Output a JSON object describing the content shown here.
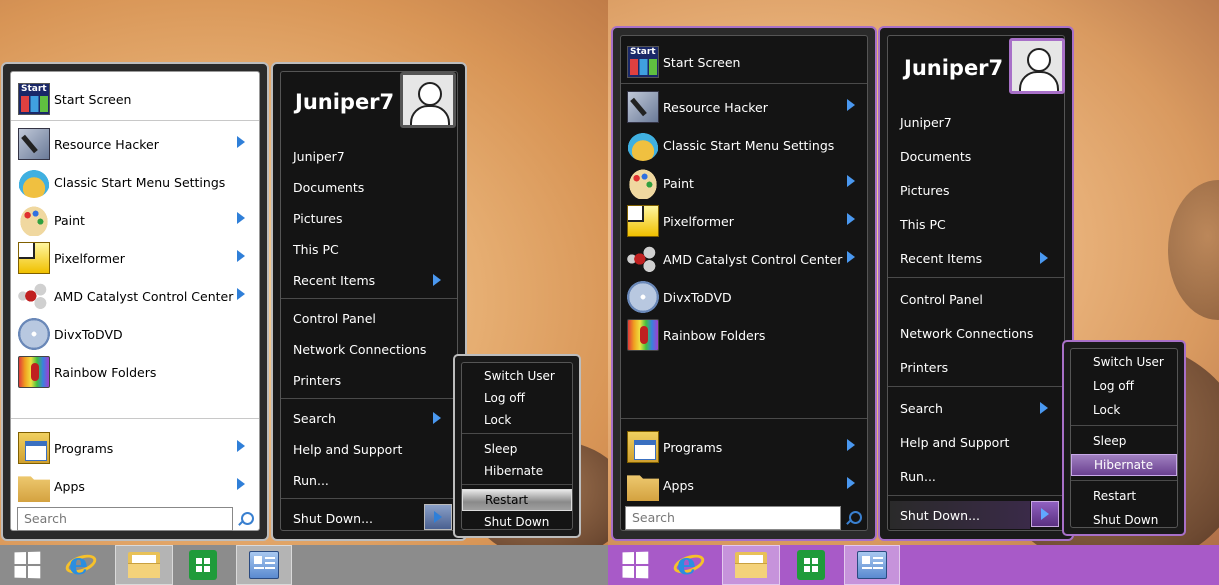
{
  "left": {
    "programs_list": [
      {
        "label": "Start Screen",
        "icon": "start-screen-icon",
        "submenu": false
      },
      {
        "label": "Resource Hacker",
        "icon": "resource-hacker-icon",
        "submenu": true
      },
      {
        "label": "Classic Start Menu Settings",
        "icon": "classic-shell-icon",
        "submenu": false
      },
      {
        "label": "Paint",
        "icon": "paint-icon",
        "submenu": true
      },
      {
        "label": "Pixelformer",
        "icon": "pixelformer-icon",
        "submenu": true
      },
      {
        "label": "AMD Catalyst Control Center",
        "icon": "amd-catalyst-icon",
        "submenu": true
      },
      {
        "label": "DivxToDVD",
        "icon": "divxtodvd-icon",
        "submenu": false
      },
      {
        "label": "Rainbow Folders",
        "icon": "rainbow-folders-icon",
        "submenu": false
      }
    ],
    "programs_label": "Programs",
    "apps_label": "Apps",
    "search_placeholder": "Search",
    "user_name": "Juniper7",
    "right_items": [
      {
        "label": "Juniper7",
        "submenu": false
      },
      {
        "label": "Documents",
        "submenu": false
      },
      {
        "label": "Pictures",
        "submenu": false
      },
      {
        "label": "This PC",
        "submenu": false
      },
      {
        "label": "Recent Items",
        "submenu": true
      },
      {
        "label": "Control Panel",
        "submenu": false
      },
      {
        "label": "Network Connections",
        "submenu": false
      },
      {
        "label": "Printers",
        "submenu": false
      },
      {
        "label": "Search",
        "submenu": true
      },
      {
        "label": "Help and Support",
        "submenu": false
      },
      {
        "label": "Run...",
        "submenu": false
      }
    ],
    "shutdown_label": "Shut Down...",
    "power_menu": [
      "Switch User",
      "Log off",
      "Lock",
      "Sleep",
      "Hibernate",
      "Restart",
      "Shut Down"
    ],
    "power_highlighted": "Restart"
  },
  "right": {
    "programs_list": [
      {
        "label": "Start Screen",
        "icon": "start-screen-icon",
        "submenu": false
      },
      {
        "label": "Resource Hacker",
        "icon": "resource-hacker-icon",
        "submenu": true
      },
      {
        "label": "Classic Start Menu Settings",
        "icon": "classic-shell-icon",
        "submenu": false
      },
      {
        "label": "Paint",
        "icon": "paint-icon",
        "submenu": true
      },
      {
        "label": "Pixelformer",
        "icon": "pixelformer-icon",
        "submenu": true
      },
      {
        "label": "AMD Catalyst Control Center",
        "icon": "amd-catalyst-icon",
        "submenu": true
      },
      {
        "label": "DivxToDVD",
        "icon": "divxtodvd-icon",
        "submenu": false
      },
      {
        "label": "Rainbow Folders",
        "icon": "rainbow-folders-icon",
        "submenu": false
      }
    ],
    "programs_label": "Programs",
    "apps_label": "Apps",
    "search_placeholder": "Search",
    "user_name": "Juniper7",
    "right_items": [
      {
        "label": "Juniper7",
        "submenu": false
      },
      {
        "label": "Documents",
        "submenu": false
      },
      {
        "label": "Pictures",
        "submenu": false
      },
      {
        "label": "This PC",
        "submenu": false
      },
      {
        "label": "Recent Items",
        "submenu": true
      },
      {
        "label": "Control Panel",
        "submenu": false
      },
      {
        "label": "Network Connections",
        "submenu": false
      },
      {
        "label": "Printers",
        "submenu": false
      },
      {
        "label": "Search",
        "submenu": true
      },
      {
        "label": "Help and Support",
        "submenu": false
      },
      {
        "label": "Run...",
        "submenu": false
      }
    ],
    "shutdown_label": "Shut Down...",
    "power_menu": [
      "Switch User",
      "Log off",
      "Lock",
      "Sleep",
      "Hibernate",
      "Restart",
      "Shut Down"
    ],
    "power_highlighted": "Hibernate"
  },
  "start_icon_text": "Start",
  "taskbar": {
    "buttons": [
      "windows-start-icon",
      "internet-explorer-icon",
      "file-explorer-icon",
      "windows-store-icon",
      "classic-shell-settings-icon"
    ],
    "left_color": "#8c8c8c",
    "right_color": "#a85ac8"
  },
  "colors": {
    "accent_blue": "#2f7fd8",
    "purple_frame": "#a870c8"
  }
}
